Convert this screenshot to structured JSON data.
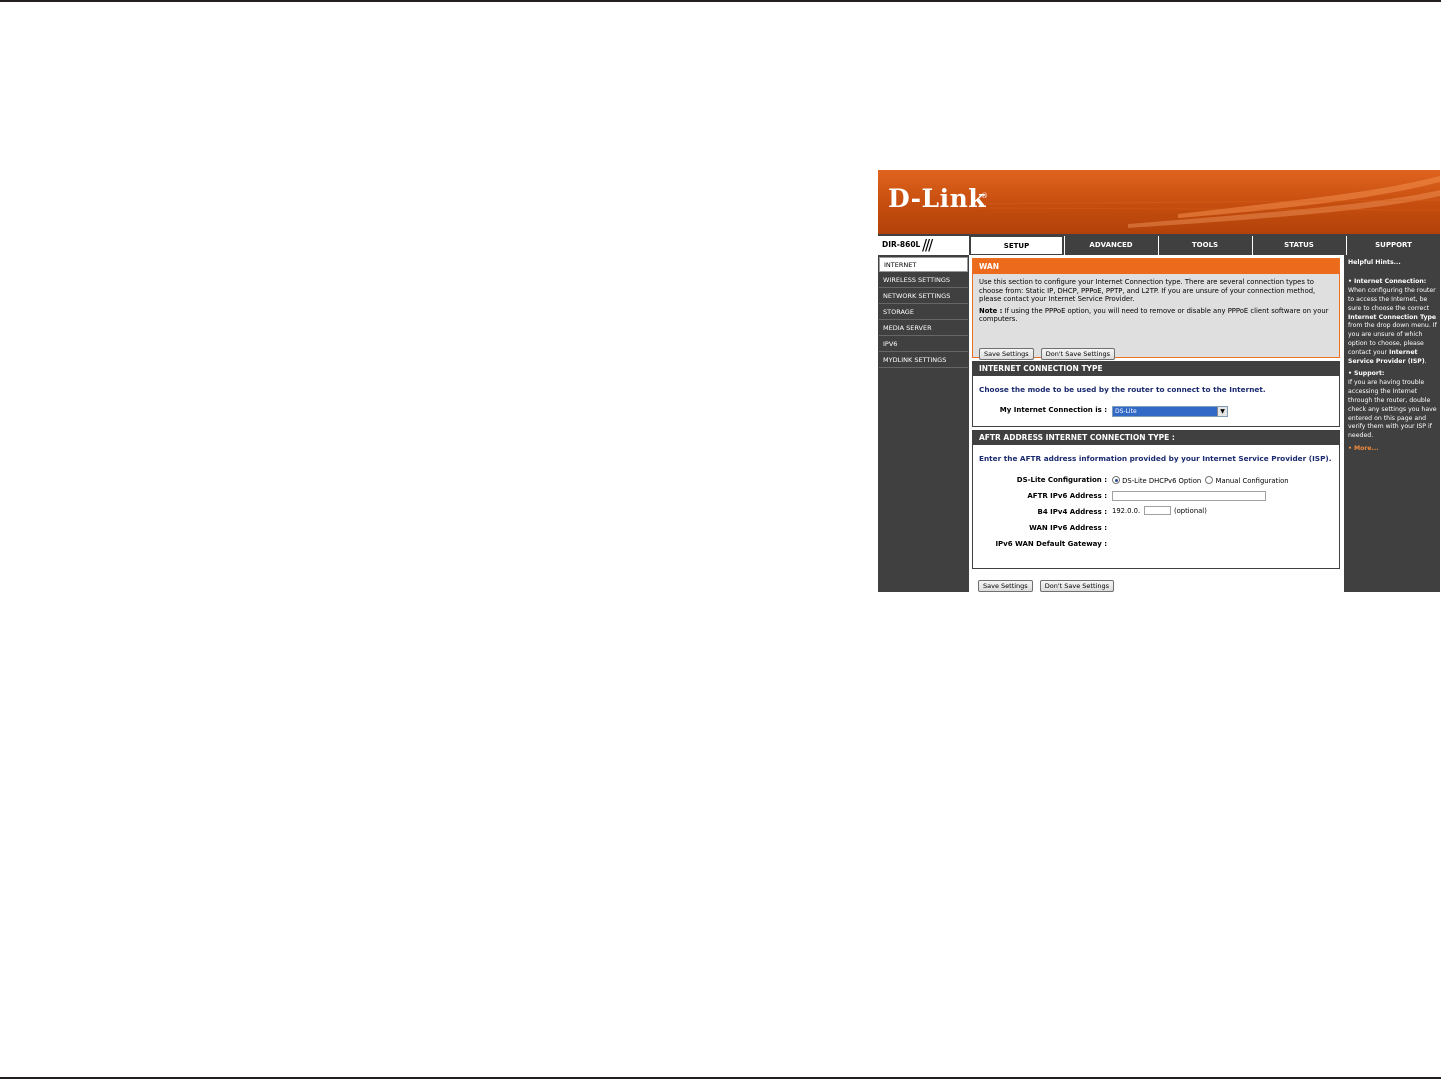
{
  "brand": {
    "logo": "D-Link",
    "registered": "®",
    "model": "DIR-860L",
    "slashes": "///"
  },
  "tabs": [
    {
      "label": "SETUP",
      "active": true
    },
    {
      "label": "ADVANCED",
      "active": false
    },
    {
      "label": "TOOLS",
      "active": false
    },
    {
      "label": "STATUS",
      "active": false
    },
    {
      "label": "SUPPORT",
      "active": false
    }
  ],
  "sidebar": {
    "items": [
      {
        "label": "INTERNET",
        "active": true
      },
      {
        "label": "WIRELESS SETTINGS",
        "active": false
      },
      {
        "label": "NETWORK SETTINGS",
        "active": false
      },
      {
        "label": "STORAGE",
        "active": false
      },
      {
        "label": "MEDIA SERVER",
        "active": false
      },
      {
        "label": "IPV6",
        "active": false
      },
      {
        "label": "MYDLINK SETTINGS",
        "active": false
      }
    ]
  },
  "wan": {
    "title": "WAN",
    "description": "Use this section to configure your Internet Connection type. There are several connection types to choose from: Static IP, DHCP, PPPoE, PPTP, and L2TP. If you are unsure of your connection method, please contact your Internet Service Provider.",
    "note_label": "Note :",
    "note_text": " If using the PPPoE option, you will need to remove or disable any PPPoE client software on your computers.",
    "save_label": "Save Settings",
    "dont_save_label": "Don't Save Settings"
  },
  "connection_type": {
    "title": "INTERNET CONNECTION TYPE",
    "intro": "Choose the mode to be used by the router to connect to the Internet.",
    "field_label": "My Internet Connection is :",
    "selected": "DS-Lite",
    "arrow": "▼"
  },
  "aftr": {
    "title": "AFTR ADDRESS INTERNET CONNECTION TYPE :",
    "intro": "Enter the AFTR address information provided by your Internet Service Provider (ISP).",
    "dslite_label": "DS-Lite Configuration :",
    "option_dhcp": "DS-Lite DHCPv6 Option",
    "option_manual": "Manual Configuration",
    "aftr_label": "AFTR IPv6 Address :",
    "aftr_value": "",
    "b4_label": "B4 IPv4 Address :",
    "b4_prefix": "192.0.0.",
    "b4_value": "",
    "b4_optional": "(optional)",
    "wan_ipv6_label": "WAN IPv6 Address :",
    "gateway_label": "IPv6 WAN Default Gateway :"
  },
  "bottom": {
    "save_label": "Save Settings",
    "dont_save_label": "Don't Save Settings"
  },
  "hints": {
    "title": "Helpful Hints...",
    "bullet": "•",
    "ic_title": "Internet Connection:",
    "ic_text1": "When configuring the router to access the Internet, be sure to choose the correct ",
    "ic_bold": "Internet Connection Type",
    "ic_text2": " from the drop down menu. If you are unsure of which option to choose, please contact your ",
    "ic_bold2": "Internet Service Provider (ISP)",
    "ic_end": ".",
    "support_title": "Support:",
    "support_text": "If you are having trouble accessing the Internet through the router, double check any settings you have entered on this page and verify them with your ISP if needed.",
    "more": "More..."
  },
  "colors": {
    "orange": "#ec6a1c",
    "dark": "#404040",
    "navy": "#1a2a6e"
  }
}
